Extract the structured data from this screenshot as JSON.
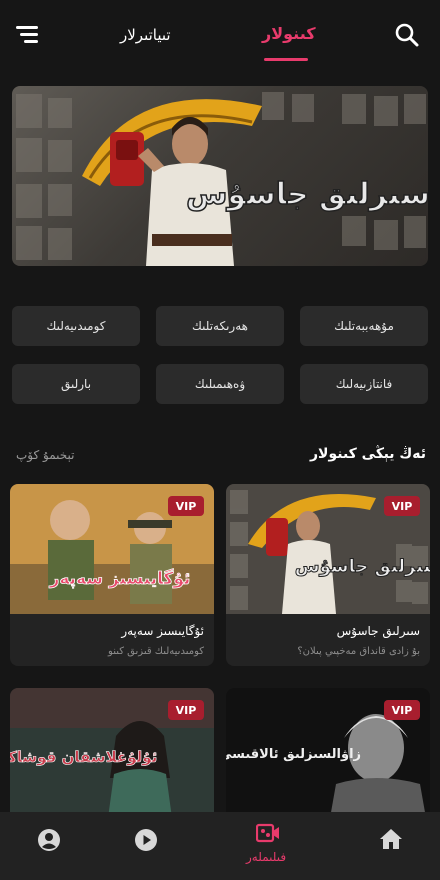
{
  "header": {
    "tabs": [
      {
        "label": "كىنولار",
        "active": true
      },
      {
        "label": "تىياتىرلار",
        "active": false
      }
    ],
    "accent_color": "#e83b6c"
  },
  "banner": {
    "title_art": "سىرلىق جاسۇس"
  },
  "categories": [
    "مۇھەببەتلىك",
    "ھەرىكەتلىك",
    "كومىدىيەلىك",
    "فانتازىيەلىك",
    "ۋەھىمىلىك",
    "بارلىق"
  ],
  "section": {
    "title": "ئەڭ يېڭى كىنولار",
    "more": "تېخىمۇ كۆپ"
  },
  "movies": [
    {
      "title": "سىرلىق جاسۇس",
      "desc": "بۇ زادى قانداق مەخپىي پىلان؟",
      "badge": "VIP",
      "poster_art": "سىرلىق جاسۇس"
    },
    {
      "title": "ئۇگايىسىز سەپەر",
      "desc": "كومىدىيەلىك قىزىق كىنو",
      "badge": "VIP",
      "poster_art": "ئۇگايىسىز سەپەر"
    },
    {
      "title": "",
      "desc": "",
      "badge": "VIP",
      "poster_art": "ئۇلۇغلاشقان قوشاكۆزلەر"
    },
    {
      "title": "",
      "desc": "",
      "badge": "VIP",
      "poster_art": "زاۋالسىزلىق ئالاقىسى"
    }
  ],
  "bottom_nav": {
    "items": [
      {
        "icon": "home-icon",
        "label": ""
      },
      {
        "icon": "movie-camera-icon",
        "label": "فىلىملەر",
        "active": true
      },
      {
        "icon": "play-icon",
        "label": ""
      },
      {
        "icon": "user-icon",
        "label": ""
      }
    ]
  }
}
